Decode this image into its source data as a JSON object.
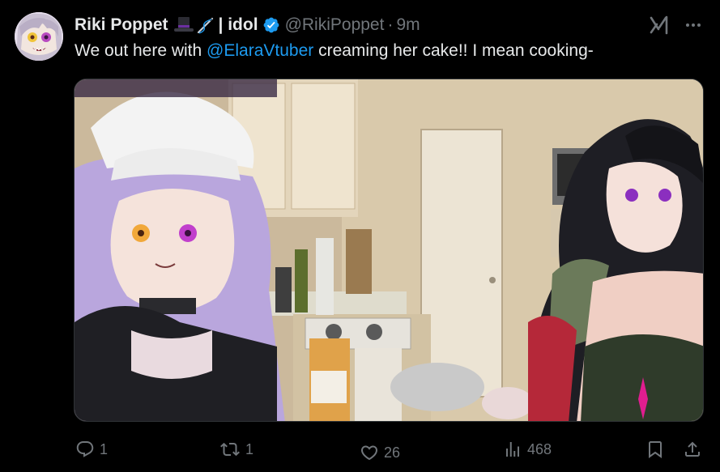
{
  "tweet": {
    "author": {
      "display_name": "Riki Poppet",
      "name_suffix": "| idol",
      "handle": "@RikiPoppet",
      "emojis": [
        "top-hat",
        "needle"
      ]
    },
    "time": "9m",
    "separator": "·",
    "text": {
      "prefix": "We out here with ",
      "mention": "@ElaraVtuber",
      "suffix": " creaming her cake!! I mean cooking-"
    },
    "stats": {
      "replies": "1",
      "reposts": "1",
      "likes": "26",
      "views": "468"
    }
  },
  "colors": {
    "background": "#000000",
    "text": "#e7e9ea",
    "muted": "#71767b",
    "accent": "#1d9bf0"
  },
  "icons": [
    "grok-icon",
    "more-icon",
    "reply-icon",
    "repost-icon",
    "like-icon",
    "views-icon",
    "bookmark-icon",
    "share-icon",
    "verified-icon"
  ]
}
